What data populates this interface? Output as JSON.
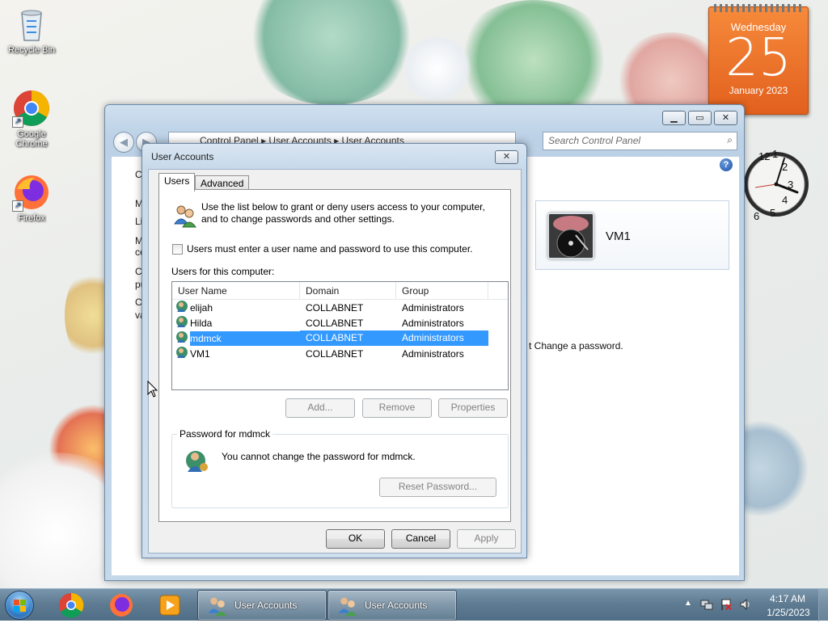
{
  "desktop": {
    "icons": [
      {
        "label": "Recycle Bin"
      },
      {
        "label": "Google Chrome"
      },
      {
        "label": "Firefox"
      }
    ],
    "calendar": {
      "weekday": "Wednesday",
      "day": "25",
      "month_year": "January 2023"
    },
    "clock": {
      "numerals": [
        "12",
        "1",
        "2",
        "3",
        "4",
        "5",
        "6"
      ]
    }
  },
  "control_panel": {
    "breadcrumb": [
      "Control Panel",
      "User Accounts",
      "User Accounts"
    ],
    "search_placeholder": "Search Control Panel",
    "left_letters": [
      "C",
      "M",
      "Li",
      "M",
      "ce",
      "C",
      "pu",
      "C",
      "va"
    ],
    "account_card_name": "VM1",
    "change_password_link": "t Change a password.",
    "caption_buttons": [
      "minimize",
      "maximize",
      "close"
    ]
  },
  "dialog": {
    "title": "User Accounts",
    "tabs": [
      {
        "label": "Users",
        "active": true
      },
      {
        "label": "Advanced",
        "active": false
      }
    ],
    "intro": "Use the list below to grant or deny users access to your computer, and to change passwords and other settings.",
    "require_login_label": "Users must enter a user name and password to use this computer.",
    "require_login_checked": false,
    "users_label": "Users for this computer:",
    "columns": [
      "User Name",
      "Domain",
      "Group"
    ],
    "users": [
      {
        "name": "elijah",
        "domain": "COLLABNET",
        "group": "Administrators",
        "selected": false
      },
      {
        "name": "Hilda",
        "domain": "COLLABNET",
        "group": "Administrators",
        "selected": false
      },
      {
        "name": "mdmck",
        "domain": "COLLABNET",
        "group": "Administrators",
        "selected": true
      },
      {
        "name": "VM1",
        "domain": "COLLABNET",
        "group": "Administrators",
        "selected": false
      }
    ],
    "buttons": {
      "add": "Add...",
      "remove": "Remove",
      "properties": "Properties"
    },
    "password_group_label": "Password for mdmck",
    "password_text": "You cannot change the password for mdmck.",
    "reset_password": "Reset Password...",
    "footer": {
      "ok": "OK",
      "cancel": "Cancel",
      "apply": "Apply"
    }
  },
  "taskbar": {
    "pinned": [
      "start-orb",
      "chrome-icon",
      "firefox-icon",
      "media-player-icon"
    ],
    "windows": [
      {
        "label": "User Accounts"
      },
      {
        "label": "User Accounts"
      }
    ],
    "time": "4:17 AM",
    "date": "1/25/2023"
  }
}
